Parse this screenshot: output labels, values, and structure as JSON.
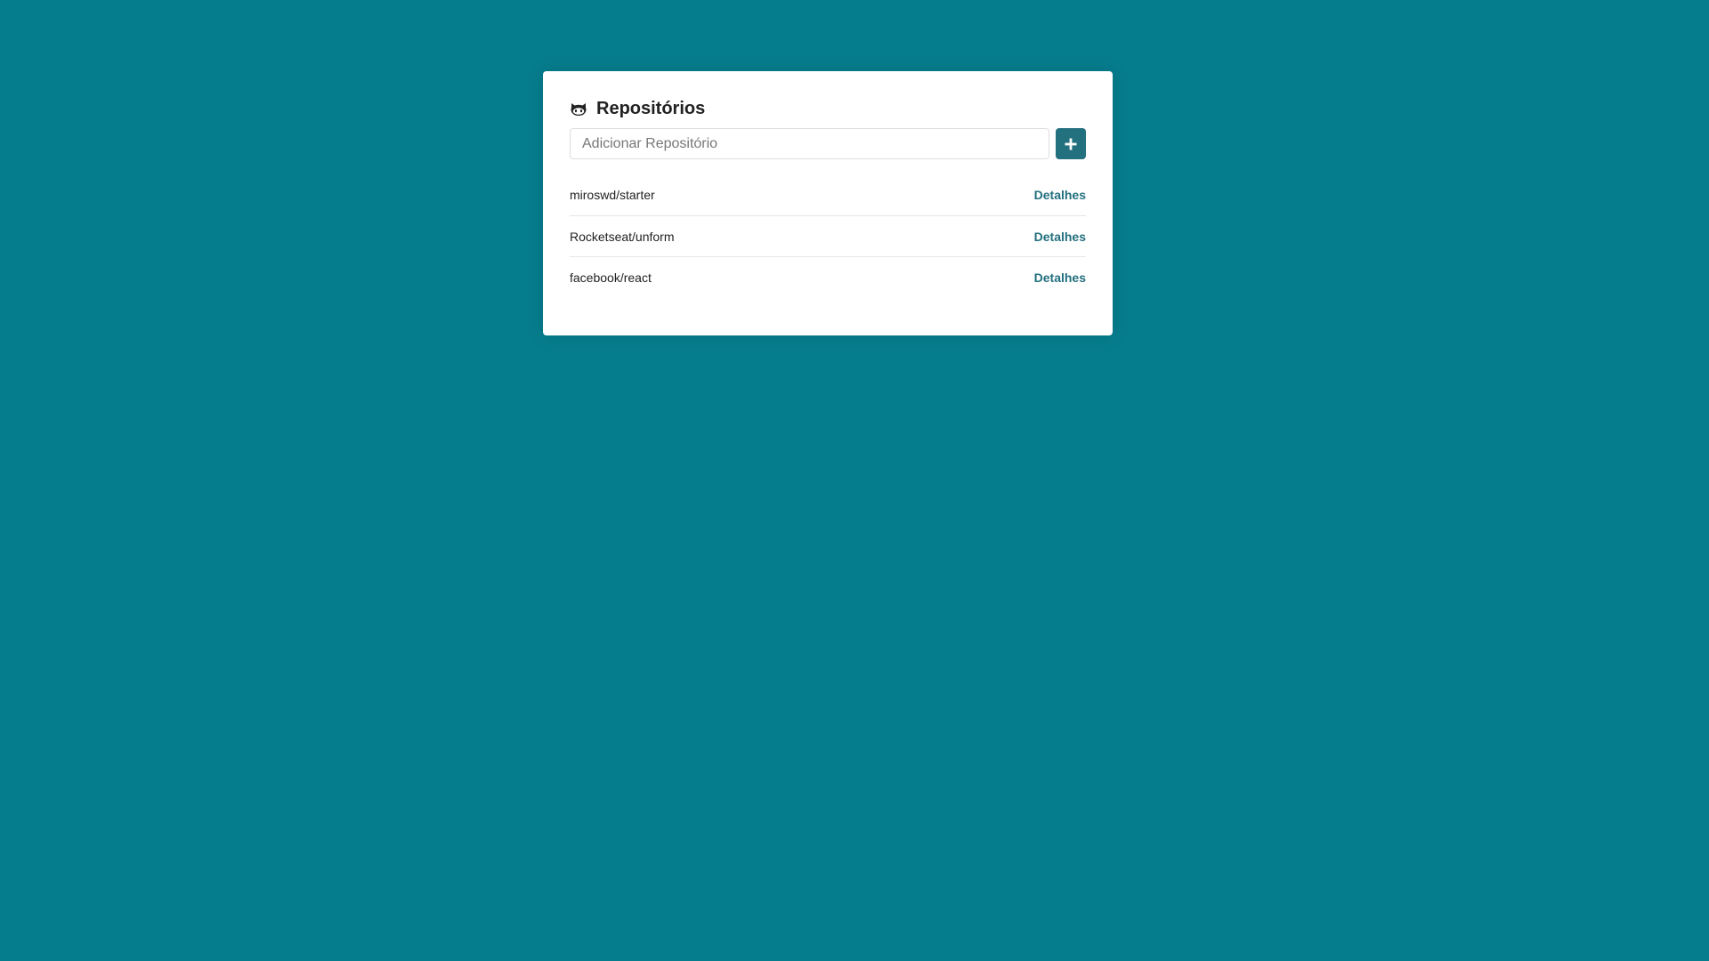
{
  "colors": {
    "background": "#067d8d",
    "accent": "#23707e",
    "card": "#ffffff"
  },
  "header": {
    "icon": "github-icon",
    "title": "Repositórios"
  },
  "form": {
    "input_value": "",
    "input_placeholder": "Adicionar Repositório",
    "add_button_icon": "plus-icon"
  },
  "repositories": [
    {
      "name": "miroswd/starter",
      "link_label": "Detalhes"
    },
    {
      "name": "Rocketseat/unform",
      "link_label": "Detalhes"
    },
    {
      "name": "facebook/react",
      "link_label": "Detalhes"
    }
  ]
}
